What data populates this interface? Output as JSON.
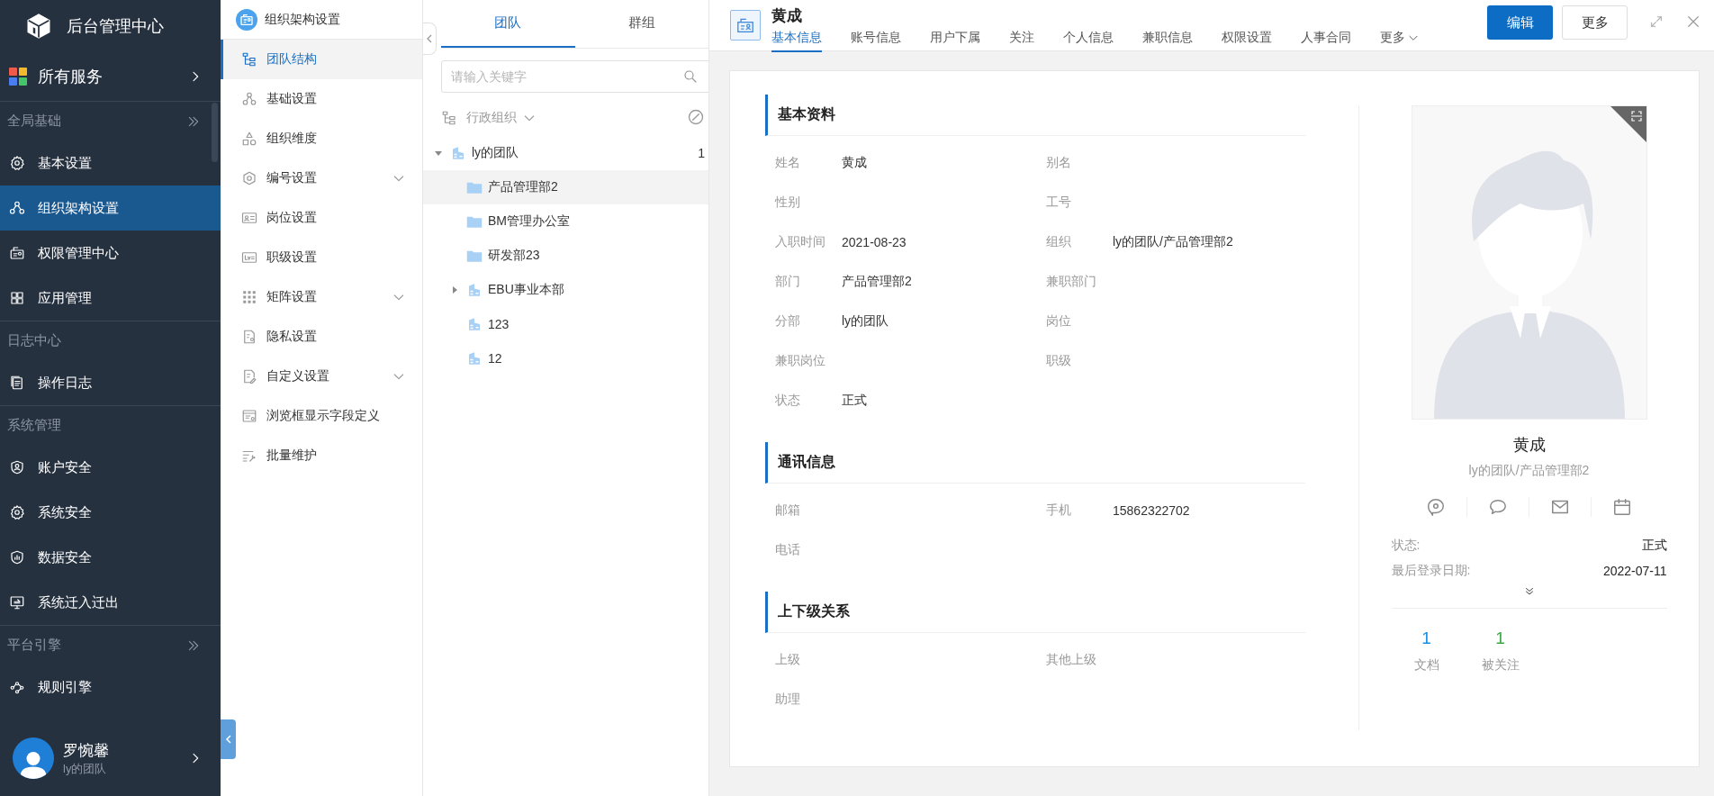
{
  "sidebar": {
    "title": "后台管理中心",
    "all_services": "所有服务",
    "sections": [
      {
        "title": "全局基础",
        "expandable": true,
        "items": [
          {
            "label": "基本设置",
            "selected": false
          },
          {
            "label": "组织架构设置",
            "selected": true
          },
          {
            "label": "权限管理中心",
            "selected": false
          },
          {
            "label": "应用管理",
            "selected": false
          }
        ]
      },
      {
        "title": "日志中心",
        "expandable": false,
        "items": [
          {
            "label": "操作日志",
            "selected": false
          }
        ]
      },
      {
        "title": "系统管理",
        "expandable": false,
        "items": [
          {
            "label": "账户安全",
            "selected": false
          },
          {
            "label": "系统安全",
            "selected": false
          },
          {
            "label": "数据安全",
            "selected": false
          },
          {
            "label": "系统迁入迁出",
            "selected": false
          }
        ]
      },
      {
        "title": "平台引擎",
        "expandable": true,
        "items": [
          {
            "label": "规则引擎",
            "selected": false
          }
        ]
      }
    ],
    "user": {
      "name": "罗惋馨",
      "team": "ly的团队"
    }
  },
  "submenu": {
    "title": "组织架构设置",
    "items": [
      {
        "label": "团队结构",
        "kind": "item",
        "selected": true
      },
      {
        "label": "基础设置",
        "kind": "item",
        "selected": false
      },
      {
        "label": "组织维度",
        "kind": "item",
        "selected": false
      },
      {
        "label": "编号设置",
        "kind": "group",
        "selected": false
      },
      {
        "label": "岗位设置",
        "kind": "item",
        "selected": false
      },
      {
        "label": "职级设置",
        "kind": "item",
        "selected": false
      },
      {
        "label": "矩阵设置",
        "kind": "group",
        "selected": false
      },
      {
        "label": "隐私设置",
        "kind": "item",
        "selected": false
      },
      {
        "label": "自定义设置",
        "kind": "group",
        "selected": false
      },
      {
        "label": "浏览框显示字段定义",
        "kind": "item",
        "selected": false
      },
      {
        "label": "批量维护",
        "kind": "item",
        "selected": false
      }
    ]
  },
  "org_panel": {
    "tabs": [
      {
        "label": "团队",
        "selected": true
      },
      {
        "label": "群组",
        "selected": false
      }
    ],
    "search": {
      "placeholder": "请输入关键字"
    },
    "view": "行政组织",
    "tree": [
      {
        "label": "ly的团队",
        "kind": "company",
        "count": "1",
        "expanded": true,
        "selected": false,
        "children": [
          {
            "label": "产品管理部2",
            "kind": "department",
            "selected": true
          },
          {
            "label": "BM管理办公室",
            "kind": "department",
            "selected": false
          },
          {
            "label": "研发部23",
            "kind": "department",
            "selected": false
          },
          {
            "label": "EBU事业本部",
            "kind": "company",
            "expanded": false,
            "selected": false
          },
          {
            "label": "123",
            "kind": "company",
            "selected": false
          },
          {
            "label": "12",
            "kind": "company",
            "selected": false
          }
        ]
      }
    ]
  },
  "detail": {
    "name": "黄成",
    "tabs": [
      {
        "label": "基本信息",
        "selected": true
      },
      {
        "label": "账号信息",
        "selected": false
      },
      {
        "label": "用户下属",
        "selected": false
      },
      {
        "label": "关注",
        "selected": false
      },
      {
        "label": "个人信息",
        "selected": false
      },
      {
        "label": "兼职信息",
        "selected": false
      },
      {
        "label": "权限设置",
        "selected": false
      },
      {
        "label": "人事合同",
        "selected": false
      }
    ],
    "more_tab": "更多",
    "buttons": [
      {
        "label": "编辑",
        "primary": true
      },
      {
        "label": "更多",
        "primary": false
      }
    ],
    "sections": [
      {
        "title": "基本资料",
        "fields": [
          {
            "label": "姓名",
            "value": "黄成"
          },
          {
            "label": "别名"
          },
          {
            "label": "性别"
          },
          {
            "label": "工号"
          },
          {
            "label": "入职时间",
            "value": "2021-08-23"
          },
          {
            "label": "组织",
            "value": "ly的团队/产品管理部2"
          },
          {
            "label": "部门",
            "value": "产品管理部2"
          },
          {
            "label": "兼职部门"
          },
          {
            "label": "分部",
            "value": "ly的团队"
          },
          {
            "label": "岗位"
          },
          {
            "label": "兼职岗位"
          },
          {
            "label": "职级"
          },
          {
            "label": "状态",
            "value": "正式"
          }
        ]
      },
      {
        "title": "通讯信息",
        "fields": [
          {
            "label": "邮箱"
          },
          {
            "label": "手机",
            "value": "15862322702"
          },
          {
            "label": "电话"
          }
        ]
      },
      {
        "title": "上下级关系",
        "fields": [
          {
            "label": "上级"
          },
          {
            "label": "其他上级"
          },
          {
            "label": "助理"
          }
        ]
      }
    ],
    "profile": {
      "name": "黄成",
      "org": "ly的团队/产品管理部2",
      "info": [
        {
          "label": "状态:",
          "value": "正式"
        },
        {
          "label": "最后登录日期:",
          "value": "2022-07-11"
        }
      ],
      "stats": [
        {
          "value": "1",
          "label": "文档",
          "color": "#1890e6"
        },
        {
          "value": "1",
          "label": "被关注",
          "color": "#3aa845"
        }
      ]
    }
  }
}
